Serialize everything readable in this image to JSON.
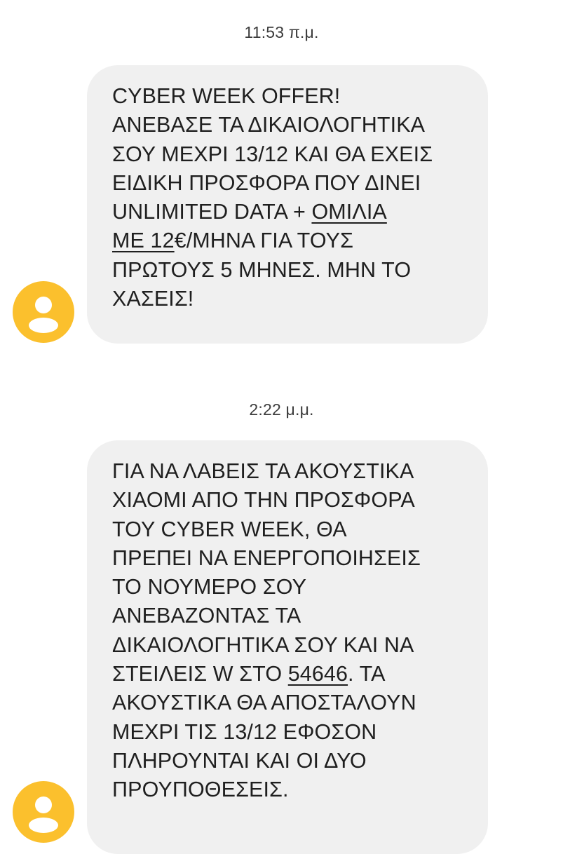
{
  "conversation": {
    "messages": [
      {
        "timestamp": "11:53 π.μ.",
        "lines": [
          [
            "CYBER WEEK OFFER!"
          ],
          [
            "ΑΝΕΒΑΣΕ ΤΑ ΔΙΚΑΙΟΛΟΓΗΤΙΚΑ"
          ],
          [
            "ΣΟΥ ΜΕΧΡΙ 13/12 ΚΑΙ ΘΑ ΕΧΕΙΣ"
          ],
          [
            "ΕΙΔΙΚΗ ΠΡΟΣΦΟΡΑ ΠΟΥ ΔΙΝΕΙ"
          ],
          [
            "UNLIMITED DATA + ",
            "ΟΜΙΛΙΑ"
          ],
          [
            "ΜΕ 12",
            "€/ΜΗΝΑ ΓΙΑ ΤΟΥΣ"
          ],
          [
            "ΠΡΩΤΟΥΣ 5 ΜΗΝΕΣ. ΜΗΝ ΤΟ"
          ],
          [
            "ΧΑΣΕΙΣ!"
          ]
        ]
      },
      {
        "timestamp": "2:22 μ.μ.",
        "lines": [
          [
            "ΓΙΑ ΝΑ ΛΑΒΕΙΣ ΤΑ ΑΚΟΥΣΤΙΚΑ"
          ],
          [
            "ΧΙΑΟΜΙ ΑΠΟ ΤΗΝ ΠΡΟΣΦΟΡΑ"
          ],
          [
            "ΤΟΥ CYBER WEEK, ΘΑ"
          ],
          [
            "ΠΡΕΠΕΙ ΝΑ ΕΝΕΡΓΟΠΟΙΗΣΕΙΣ"
          ],
          [
            "ΤΟ ΝΟΥΜΕΡΟ ΣΟΥ"
          ],
          [
            "ΑΝΕΒΑΖΟΝΤΑΣ ΤΑ"
          ],
          [
            "ΔΙΚΑΙΟΛΟΓΗΤΙΚΑ ΣΟΥ ΚΑΙ ΝΑ"
          ],
          [
            "ΣΤΕΙΛΕΙΣ W ΣΤΟ ",
            "54646",
            ". ΤΑ"
          ],
          [
            "ΑΚΟΥΣΤΙΚΑ ΘΑ ΑΠΟΣΤΑΛΟΥΝ"
          ],
          [
            "ΜΕΧΡΙ ΤΙΣ 13/12 ΕΦΟΣΟΝ"
          ],
          [
            "ΠΛΗΡΟΥΝΤΑΙ ΚΑΙ ΟΙ ΔΥΟ"
          ],
          [
            "ΠΡΟΥΠΟΘΕΣΕΙΣ."
          ]
        ]
      }
    ]
  },
  "avatar": {
    "icon": "person-icon",
    "color": "#fbc02d"
  },
  "colors": {
    "bubble": "#f0f0f0",
    "text": "#1f1f1f",
    "timestamp": "#3c3c3c"
  }
}
